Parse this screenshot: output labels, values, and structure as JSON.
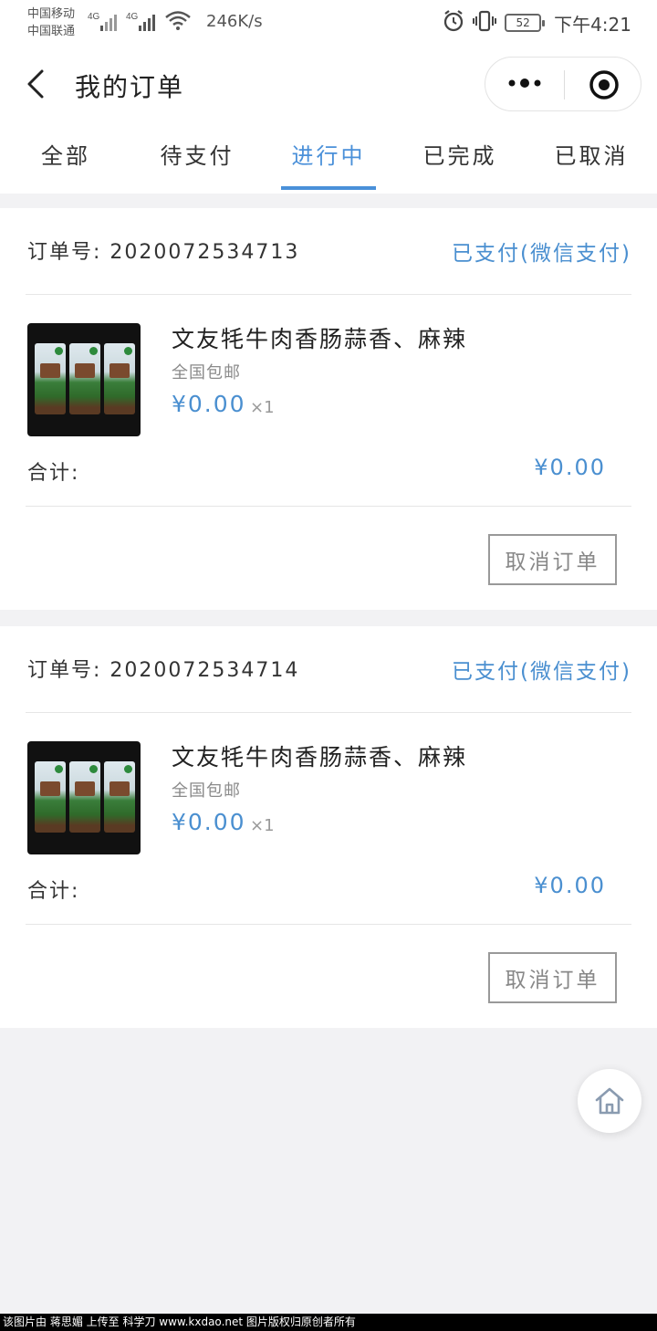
{
  "status_bar": {
    "carrier_1": "中国移动",
    "carrier_2": "中国联通",
    "signal_1_label": "4G",
    "signal_2_label": "4G",
    "net_speed": "246K/s",
    "battery": "52",
    "time": "下午4:21"
  },
  "nav": {
    "title": "我的订单"
  },
  "tabs": [
    {
      "label": "全部",
      "active": false
    },
    {
      "label": "待支付",
      "active": false
    },
    {
      "label": "进行中",
      "active": true
    },
    {
      "label": "已完成",
      "active": false
    },
    {
      "label": "已取消",
      "active": false
    }
  ],
  "orders": [
    {
      "order_no": "订单号: 2020072534713",
      "status": "已支付(微信支付)",
      "product_name": "文友牦牛肉香肠蒜香、麻辣",
      "shipping": "全国包邮",
      "price": "¥0.00",
      "qty": "×1",
      "total_label": "合计:",
      "total": "¥0.00",
      "cancel_label": "取消订单"
    },
    {
      "order_no": "订单号: 2020072534714",
      "status": "已支付(微信支付)",
      "product_name": "文友牦牛肉香肠蒜香、麻辣",
      "shipping": "全国包邮",
      "price": "¥0.00",
      "qty": "×1",
      "total_label": "合计:",
      "total": "¥0.00",
      "cancel_label": "取消订单"
    }
  ],
  "watermark": "该图片由 蒋思媚 上传至 科学刀 www.kxdao.net 图片版权归原创者所有",
  "colors": {
    "accent": "#4a90d9",
    "price": "#4a8fd0",
    "background": "#f2f2f4"
  }
}
